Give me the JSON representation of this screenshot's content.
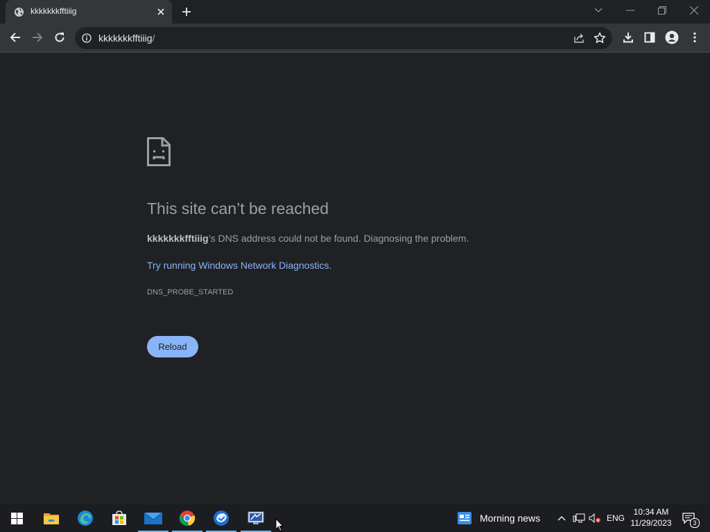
{
  "browser": {
    "tab": {
      "title": "kkkkkkkfftiiig"
    },
    "address_bar": {
      "url_host": "kkkkkkkfftiiig",
      "url_path": "/"
    }
  },
  "error_page": {
    "title": "This site can’t be reached",
    "description_host": "kkkkkkkfftiiig",
    "description_rest": "’s DNS address could not be found. Diagnosing the problem.",
    "link_prefix": "Try running ",
    "link_text": "Windows Network Diagnostics",
    "link_suffix": ".",
    "error_code": "DNS_PROBE_STARTED",
    "reload_label": "Reload"
  },
  "taskbar": {
    "pinned_icons": [
      "windows-start-icon",
      "file-explorer-icon",
      "edge-icon",
      "store-icon",
      "mail-icon",
      "chrome-icon",
      "thunderbird-icon",
      "remote-desktop-icon"
    ],
    "news_label": "Morning news",
    "language": "ENG",
    "time": "10:34 AM",
    "date": "11/29/2023",
    "notification_count": "3"
  },
  "colors": {
    "page_background": "#202124",
    "toolbar_background": "#35363a",
    "link": "#8ab4f8",
    "reload_button": "#8ab4f8",
    "taskbar_active_indicator": "#76b9ed"
  }
}
